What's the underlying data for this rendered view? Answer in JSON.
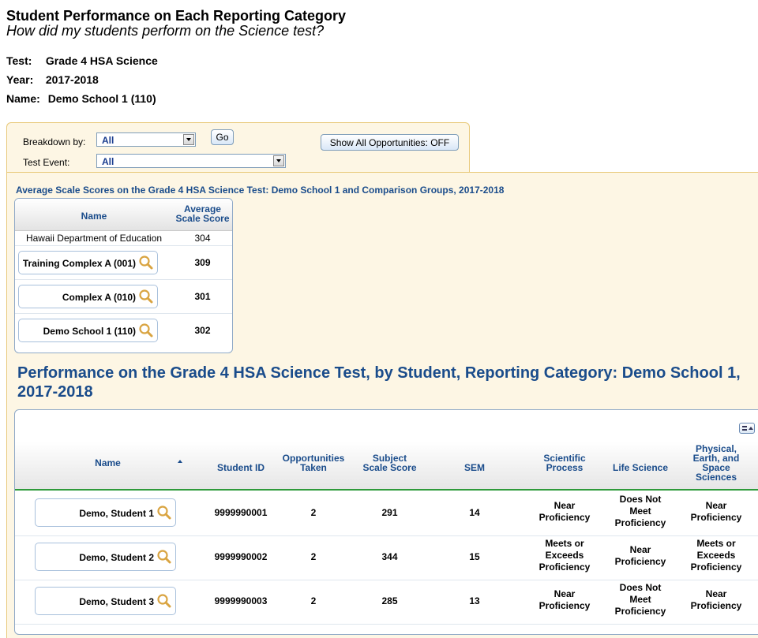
{
  "header": {
    "title": "Student Performance on Each Reporting Category",
    "subtitle": "How did my students perform on the Science test?",
    "test_label": "Test:",
    "test_value": "Grade 4 HSA Science",
    "year_label": "Year:",
    "year_value": "2017-2018",
    "name_label": "Name:",
    "name_value": "Demo School 1 (110)"
  },
  "filters": {
    "breakdown_label": "Breakdown by:",
    "breakdown_value": "All",
    "go_label": "Go",
    "show_all_label": "Show All Opportunities: OFF",
    "test_event_label": "Test Event:",
    "test_event_value": "All"
  },
  "avg_table": {
    "caption": "Average Scale Scores on the Grade 4 HSA Science Test: Demo School 1 and Comparison Groups, 2017-2018",
    "col_name": "Name",
    "col_score_1": "Average",
    "col_score_2": "Scale Score",
    "rows": [
      {
        "name": "Hawaii Department of Education",
        "score": "304"
      },
      {
        "name": "Training Complex A (001)",
        "score": "309"
      },
      {
        "name": "Complex A (010)",
        "score": "301"
      },
      {
        "name": "Demo School 1 (110)",
        "score": "302"
      }
    ]
  },
  "perf": {
    "title": "Performance on the Grade 4 HSA Science Test, by Student, Reporting Category: Demo School 1, 2017-2018",
    "columns": {
      "name": "Name",
      "student_id": "Student ID",
      "opp_1": "Opportunities",
      "opp_2": "Taken",
      "subj_1": "Subject",
      "subj_2": "Scale Score",
      "sem": "SEM",
      "sci_1": "Scientific",
      "sci_2": "Process",
      "life": "Life Science",
      "phys_1": "Physical,",
      "phys_2": "Earth, and",
      "phys_3": "Space",
      "phys_4": "Sciences"
    },
    "rows": [
      {
        "name": "Demo, Student 1",
        "id": "9999990001",
        "opp": "2",
        "score": "291",
        "sem": "14",
        "sci": [
          "Near",
          "Proficiency"
        ],
        "life": [
          "Does Not",
          "Meet",
          "Proficiency"
        ],
        "phys": [
          "Near",
          "Proficiency"
        ]
      },
      {
        "name": "Demo, Student 2",
        "id": "9999990002",
        "opp": "2",
        "score": "344",
        "sem": "15",
        "sci": [
          "Meets or",
          "Exceeds",
          "Proficiency"
        ],
        "life": [
          "Near",
          "Proficiency"
        ],
        "phys": [
          "Meets or",
          "Exceeds",
          "Proficiency"
        ]
      },
      {
        "name": "Demo, Student 3",
        "id": "9999990003",
        "opp": "2",
        "score": "285",
        "sem": "13",
        "sci": [
          "Near",
          "Proficiency"
        ],
        "life": [
          "Does Not",
          "Meet",
          "Proficiency"
        ],
        "phys": [
          "Near",
          "Proficiency"
        ]
      }
    ]
  },
  "icons": {
    "magnifier": "magnifier-icon",
    "sort": "sort-ascending-icon",
    "column_menu": "column-menu-icon",
    "dropdown": "chevron-down-icon"
  },
  "colors": {
    "heading_blue": "#1a4c8b",
    "panel_bg": "#fdf6e4",
    "panel_border": "#e8c97a",
    "header_underline": "#2e9a3a",
    "magnifier": "#d9a441"
  }
}
